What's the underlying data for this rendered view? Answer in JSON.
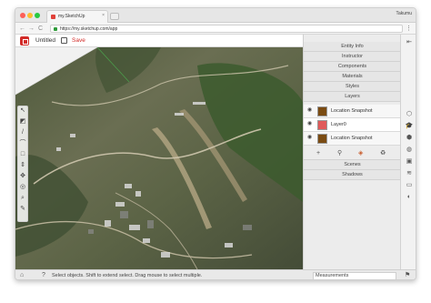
{
  "browser": {
    "tab_title": "my.SketchUp",
    "tab_close": "×",
    "profile": "Takumu",
    "url": "https://my.sketchup.com/app",
    "back": "←",
    "forward": "→",
    "reload": "C",
    "menu": "⋮"
  },
  "app": {
    "title": "Untitled",
    "save_label": "Save",
    "brand_color": "#d22b28"
  },
  "panel": {
    "sections_top": [
      "Entity Info",
      "Instructor",
      "Components",
      "Materials",
      "Styles",
      "Layers"
    ],
    "layers": [
      {
        "name": "Location Snapshot",
        "color": "#7a4b12",
        "visible": true,
        "selected": false
      },
      {
        "name": "Layer0",
        "color": "#e05a5a",
        "visible": true,
        "selected": true
      },
      {
        "name": "Location Snapshot",
        "color": "#7a4b12",
        "visible": true,
        "selected": false
      }
    ],
    "layer_tools": [
      "add-icon",
      "paint-icon",
      "color-icon",
      "recycle-icon"
    ],
    "sections_bottom": [
      "Scenes",
      "Shadows"
    ]
  },
  "toolbar": {
    "tools": [
      "select-icon",
      "eraser-icon",
      "line-icon",
      "arc-icon",
      "rectangle-icon",
      "push-pull-icon",
      "move-icon",
      "orbit-icon",
      "zoom-icon",
      "tape-icon"
    ]
  },
  "status": {
    "text": "Select objects. Shift to extend select. Drag mouse to select multiple.",
    "measurements_label": "Measurements"
  }
}
